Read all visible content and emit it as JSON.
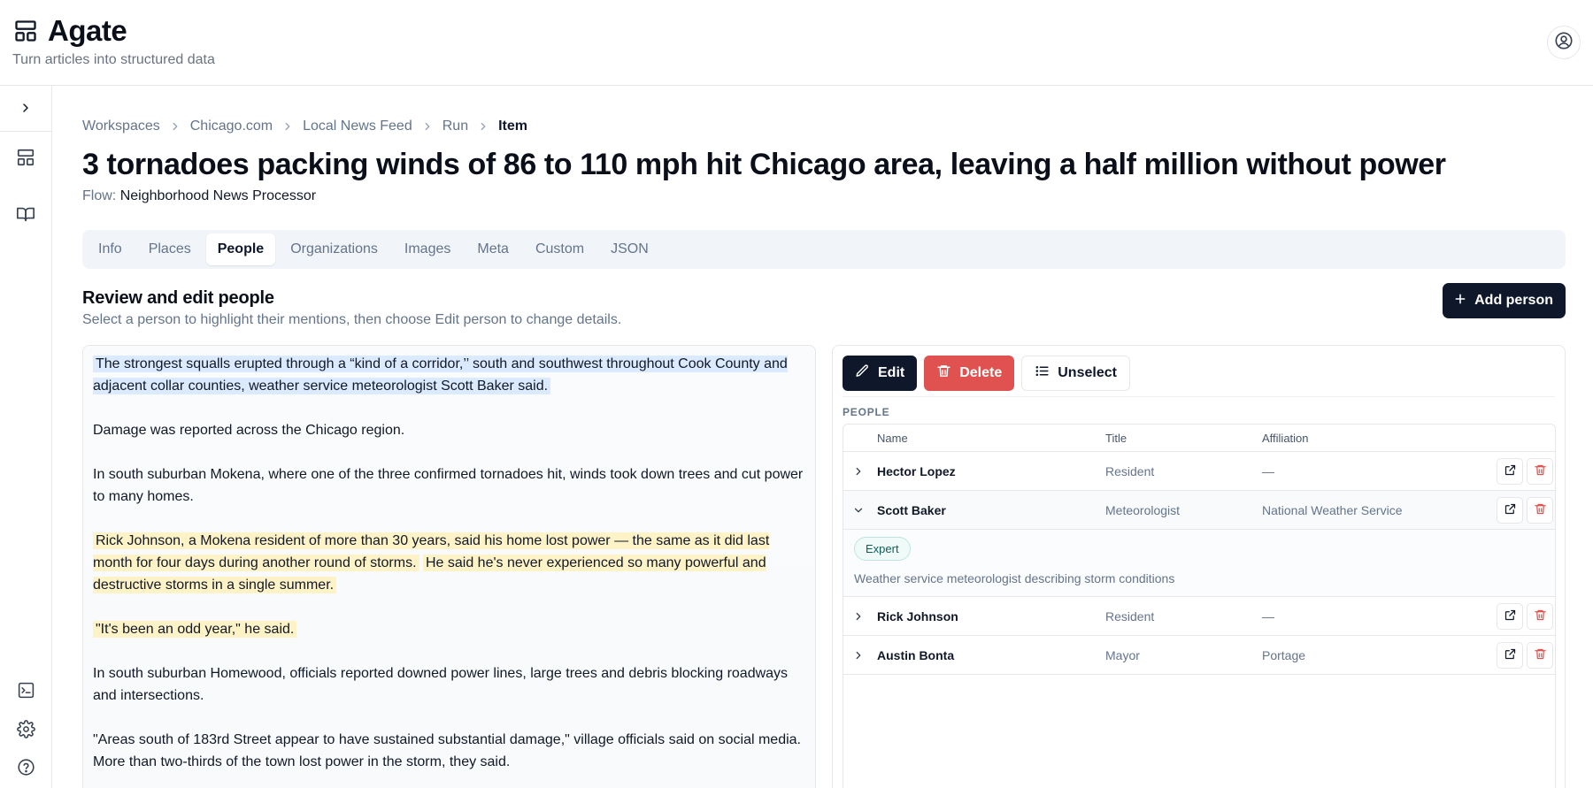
{
  "app": {
    "title": "Agate",
    "tagline": "Turn articles into structured data"
  },
  "breadcrumb": [
    "Workspaces",
    "Chicago.com",
    "Local News Feed",
    "Run",
    "Item"
  ],
  "page": {
    "title": "3 tornadoes packing winds of 86 to 110 mph hit Chicago area, leaving a half million without power",
    "flow_label": "Flow:",
    "flow_value": "Neighborhood News Processor"
  },
  "tabs": [
    "Info",
    "Places",
    "People",
    "Organizations",
    "Images",
    "Meta",
    "Custom",
    "JSON"
  ],
  "active_tab": "People",
  "section": {
    "title": "Review and edit people",
    "subtitle": "Select a person to highlight their mentions, then choose Edit person to change details.",
    "add_button": "Add person"
  },
  "article": {
    "p1": "The strongest squalls erupted through a “kind of a corridor,’’ south and southwest throughout Cook County and adjacent collar counties, weather service meteorologist Scott Baker said.",
    "p2": "Damage was reported across the Chicago region.",
    "p3": "In south suburban Mokena, where one of the three confirmed tornadoes hit, winds took down trees and cut power to many homes.",
    "p4a": "Rick Johnson, a Mokena resident of more than 30 years, said his home lost power — the same as it did last month for four days during another round of storms.",
    "p4b": "He said he's never experienced so many powerful and destructive storms in a single summer.",
    "p5": "\"It's been an odd year,\" he said.",
    "p6": "In south suburban Homewood, officials reported downed power lines, large trees and debris blocking roadways and intersections.",
    "p7": "\"Areas south of 183rd Street appear to have sustained substantial damage,\" village officials said on social media. More than two-thirds of the town lost power in the storm, they said."
  },
  "toolbar": {
    "edit": "Edit",
    "delete": "Delete",
    "unselect": "Unselect"
  },
  "people": {
    "label": "PEOPLE",
    "columns": [
      "Name",
      "Title",
      "Affiliation"
    ],
    "rows": [
      {
        "name": "Hector Lopez",
        "title": "Resident",
        "affiliation": "—"
      },
      {
        "name": "Scott Baker",
        "title": "Meteorologist",
        "affiliation": "National Weather Service",
        "badge": "Expert",
        "description": "Weather service meteorologist describing storm conditions"
      },
      {
        "name": "Rick Johnson",
        "title": "Resident",
        "affiliation": "—"
      },
      {
        "name": "Austin Bonta",
        "title": "Mayor",
        "affiliation": "Portage"
      }
    ],
    "selected": "Scott Baker"
  },
  "colors": {
    "primary": "#0f172a",
    "danger": "#e0524f",
    "highlight_selected": "#dbeafe",
    "highlight_mention": "#fef3c7"
  }
}
